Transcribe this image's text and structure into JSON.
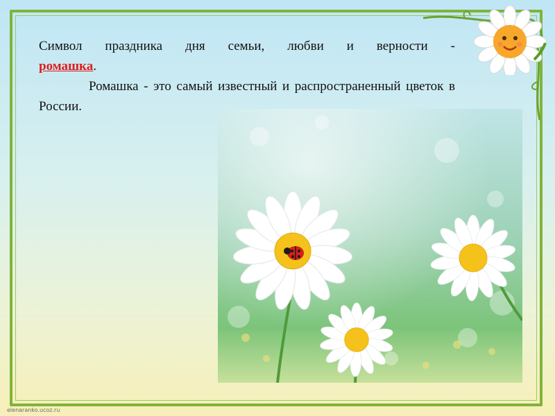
{
  "slide": {
    "line1_text": "Символ праздника дня семьи, любви и верности -",
    "accent_word": "ромашка",
    "line1_end": ".",
    "paragraph": "Ромашка - это самый известный и распространенный цветок в России."
  },
  "footer": {
    "site": "elenaranko.ucoz.ru"
  },
  "photo": {
    "subject": "daisies-with-ladybug"
  },
  "colors": {
    "frame": "#7fb43a",
    "accent": "#e31b1b"
  }
}
